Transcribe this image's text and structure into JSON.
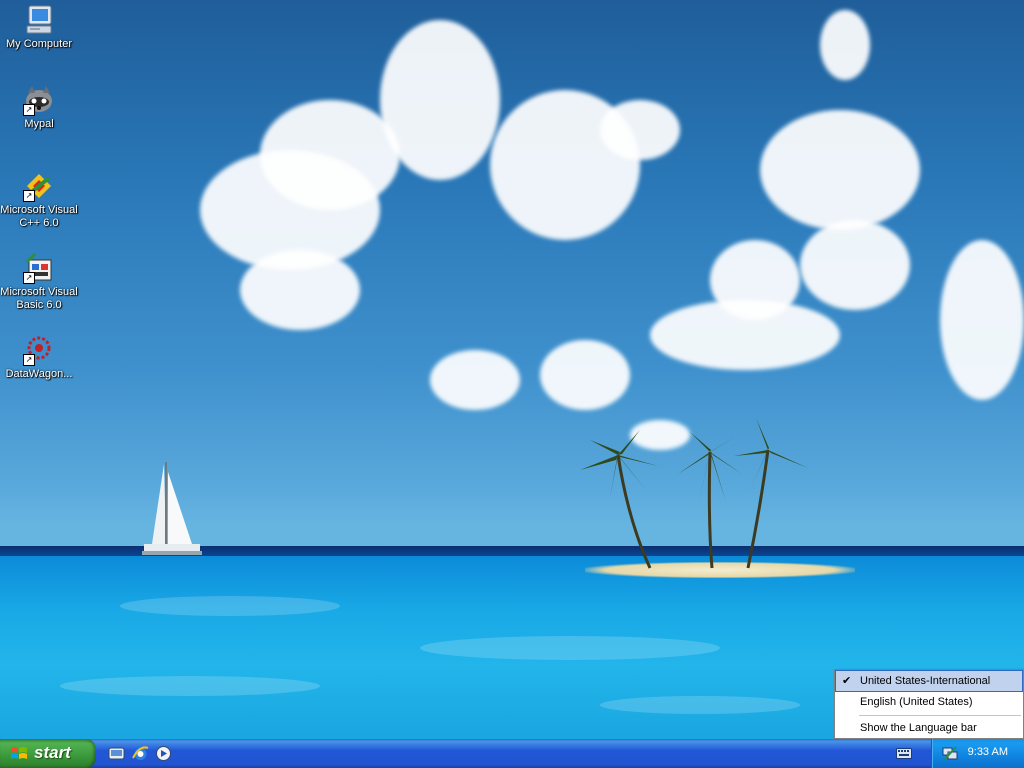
{
  "desktop": {
    "icons": [
      {
        "label": "My Computer",
        "icon": "my-computer-icon"
      },
      {
        "label": "Mypal",
        "icon": "mypal-icon"
      },
      {
        "label": "Microsoft Visual C++ 6.0",
        "icon": "visual-cpp-icon"
      },
      {
        "label": "Microsoft Visual Basic 6.0",
        "icon": "visual-basic-icon"
      },
      {
        "label": "DataWagon...",
        "icon": "datawagon-icon"
      }
    ]
  },
  "taskbar": {
    "start_label": "start",
    "quick_launch": [
      "show-desktop-icon",
      "internet-explorer-icon",
      "media-player-icon"
    ],
    "clock": "9:33 AM"
  },
  "language_menu": {
    "items": [
      {
        "label": "United States-International",
        "checked": true
      },
      {
        "label": "English (United States)",
        "checked": false
      },
      {
        "label": "Show the Language bar",
        "checked": false
      }
    ]
  },
  "colors": {
    "taskbar_blue": "#2254d0",
    "start_green": "#3a983a",
    "tray_blue": "#0f84e0",
    "menu_highlight": "#c1d2ee"
  }
}
